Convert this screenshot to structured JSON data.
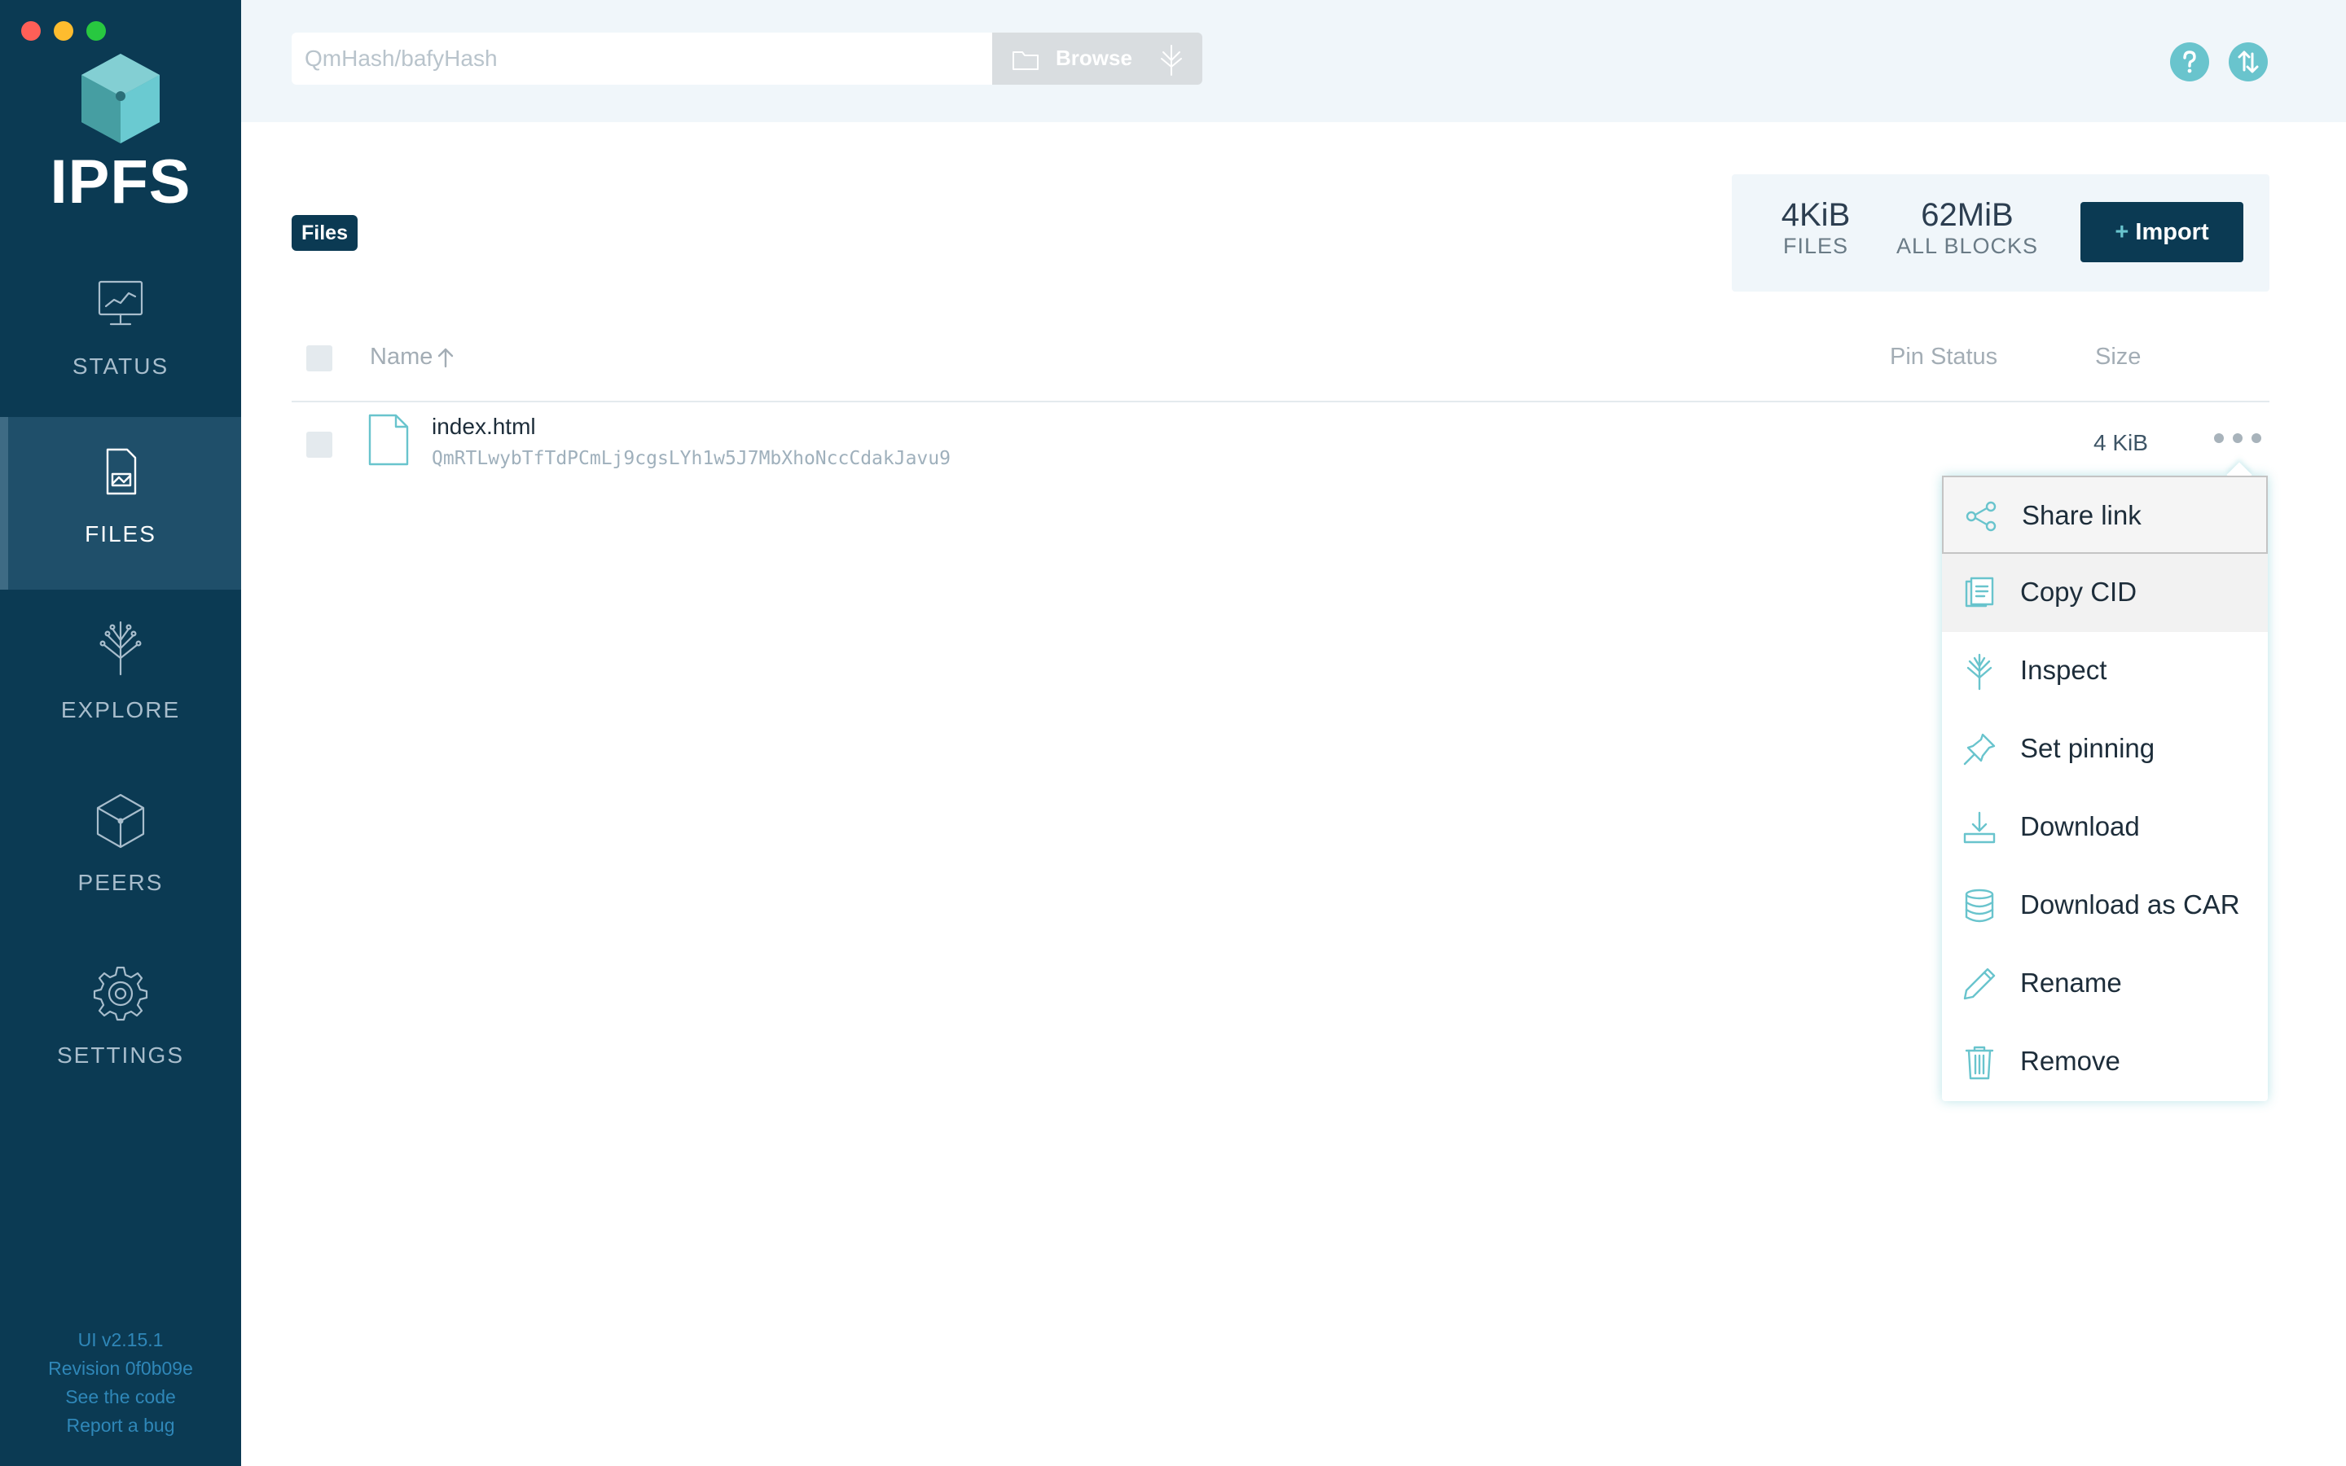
{
  "window": {
    "traffic_lights": [
      "close",
      "minimize",
      "maximize"
    ]
  },
  "sidebar": {
    "logo_text": "IPFS",
    "items": [
      {
        "label": "STATUS",
        "icon": "status-monitor-icon",
        "active": false
      },
      {
        "label": "FILES",
        "icon": "files-document-icon",
        "active": true
      },
      {
        "label": "EXPLORE",
        "icon": "explore-tree-icon",
        "active": false
      },
      {
        "label": "PEERS",
        "icon": "peers-cube-icon",
        "active": false
      },
      {
        "label": "SETTINGS",
        "icon": "settings-gear-icon",
        "active": false
      }
    ],
    "footer": {
      "version": "UI v2.15.1",
      "revision": "Revision 0f0b09e",
      "see_code": "See the code",
      "report_bug": "Report a bug"
    }
  },
  "header": {
    "search": {
      "placeholder": "QmHash/bafyHash",
      "value": ""
    },
    "browse_label": "Browse",
    "icons": [
      "help-icon",
      "sync-icon"
    ]
  },
  "main": {
    "breadcrumb": "Files",
    "stats": {
      "files_value": "4KiB",
      "files_label": "FILES",
      "blocks_value": "62MiB",
      "blocks_label": "ALL BLOCKS"
    },
    "import_plus": "+",
    "import_label": "Import",
    "table": {
      "columns": {
        "name": "Name",
        "pin_status": "Pin Status",
        "size": "Size"
      },
      "sort": "ascending",
      "rows": [
        {
          "name": "index.html",
          "cid": "QmRTLwybTfTdPCmLj9cgsLYh1w5J7MbXhoNccCdakJavu9",
          "pin_status": "",
          "size": "4 KiB"
        }
      ]
    }
  },
  "context_menu": {
    "items": [
      {
        "label": "Share link",
        "icon": "share-icon",
        "state": "focused"
      },
      {
        "label": "Copy CID",
        "icon": "copy-icon",
        "state": "hovered"
      },
      {
        "label": "Inspect",
        "icon": "inspect-tree-icon",
        "state": ""
      },
      {
        "label": "Set pinning",
        "icon": "pin-icon",
        "state": ""
      },
      {
        "label": "Download",
        "icon": "download-icon",
        "state": ""
      },
      {
        "label": "Download as CAR",
        "icon": "database-icon",
        "state": ""
      },
      {
        "label": "Rename",
        "icon": "pencil-icon",
        "state": ""
      },
      {
        "label": "Remove",
        "icon": "trash-icon",
        "state": ""
      }
    ]
  },
  "colors": {
    "sidebar_bg": "#0b3a53",
    "sidebar_active": "#1f4f6a",
    "accent_teal": "#69c4cd",
    "header_bg": "#f0f6fa",
    "link_blue": "#2f87b8"
  }
}
